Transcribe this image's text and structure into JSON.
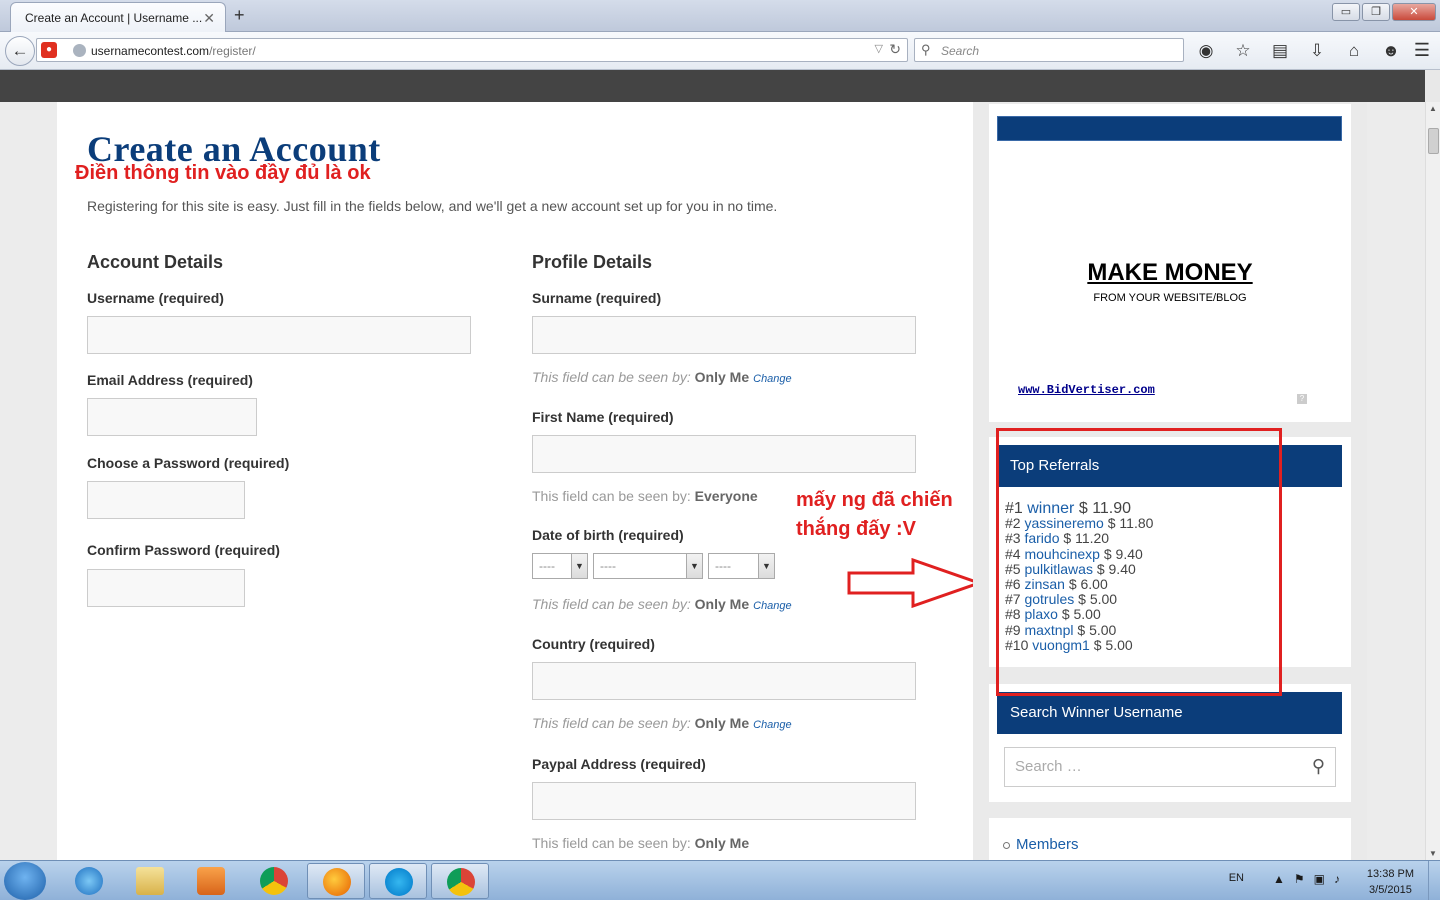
{
  "browser": {
    "tab_title": "Create an Account | Username ...",
    "tab_close": "✕",
    "new_tab": "+",
    "url_host": "usernamecontest.com",
    "url_path": "/register/",
    "search_placeholder": "Search",
    "window_buttons": {
      "minimize": "▭",
      "restore": "❐",
      "close": "✕"
    }
  },
  "page": {
    "title": "Create an Account",
    "annotation_top": "Điền thông tin vào đầy đủ là ok",
    "intro": "Registering for this site is easy. Just fill in the fields below, and we'll get a new account set up for you in no time.",
    "account_section": "Account Details",
    "profile_section": "Profile Details",
    "account_fields": [
      "Username (required)",
      "Email Address (required)",
      "Choose a Password (required)",
      "Confirm Password (required)"
    ],
    "profile_fields": [
      "Surname (required)",
      "First Name (required)",
      "Date of birth (required)",
      "Country (required)",
      "Paypal Address (required)"
    ],
    "visibility_prefix": "This field can be seen by:",
    "visibility_only_me": "Only Me",
    "visibility_everyone": "Everyone",
    "change_link": "Change",
    "dob_placeholder": "----",
    "annotation_side_line1": "mấy ng đã chiến",
    "annotation_side_line2": "thắng đấy :V"
  },
  "sidebar": {
    "ad_title": "MAKE MONEY",
    "ad_subtitle": "FROM YOUR WEBSITE/BLOG",
    "ad_link": "www.BidVertiser.com",
    "ad_help": "?",
    "top_referrals_title": "Top Referrals",
    "referrals": [
      {
        "rank": "#1",
        "user": "winner",
        "amount": "$ 11.90"
      },
      {
        "rank": "#2",
        "user": "yassineremo",
        "amount": "$ 11.80"
      },
      {
        "rank": "#3",
        "user": "farido",
        "amount": "$ 11.20"
      },
      {
        "rank": "#4",
        "user": "mouhcinexp",
        "amount": "$ 9.40"
      },
      {
        "rank": "#5",
        "user": "pulkitlawas",
        "amount": "$ 9.40"
      },
      {
        "rank": "#6",
        "user": "zinsan",
        "amount": "$ 6.00"
      },
      {
        "rank": "#7",
        "user": "gotrules",
        "amount": "$ 5.00"
      },
      {
        "rank": "#8",
        "user": "plaxo",
        "amount": "$ 5.00"
      },
      {
        "rank": "#9",
        "user": "maxtnpl",
        "amount": "$ 5.00"
      },
      {
        "rank": "#10",
        "user": "vuongm1",
        "amount": "$ 5.00"
      }
    ],
    "search_title": "Search Winner Username",
    "search_placeholder": "Search …",
    "members_link": "Members"
  },
  "taskbar": {
    "language": "EN",
    "time": "13:38 PM",
    "date": "3/5/2015"
  },
  "colors": {
    "brand_blue": "#0b3d7a",
    "annotation_red": "#e02020",
    "link_blue": "#1a5ea8"
  }
}
